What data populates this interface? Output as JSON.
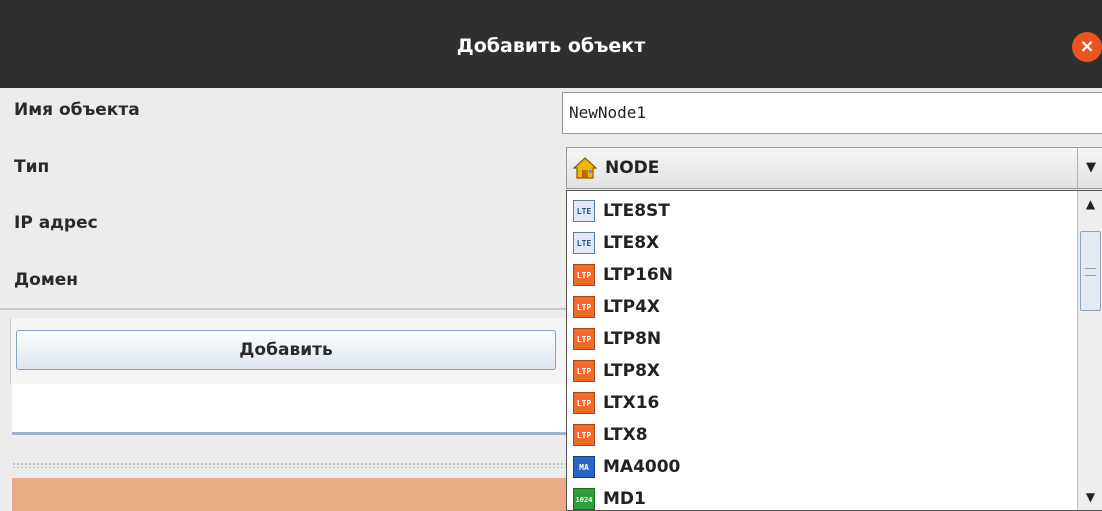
{
  "window": {
    "title": "Добавить объект",
    "close_icon": "×"
  },
  "form": {
    "name_label": "Имя объекта",
    "name_value": "NewNode1",
    "type_label": "Тип",
    "type_value": "NODE",
    "ip_label": "IP адрес",
    "domain_label": "Домен",
    "add_button": "Добавить"
  },
  "type_dropdown": {
    "items": [
      {
        "label": "LTE8ST",
        "icon": "lte-icon",
        "icon_text": "LTE"
      },
      {
        "label": "LTE8X",
        "icon": "lte-icon",
        "icon_text": "LTE"
      },
      {
        "label": "LTP16N",
        "icon": "ltp-icon",
        "icon_text": "LTP"
      },
      {
        "label": "LTP4X",
        "icon": "ltp-icon",
        "icon_text": "LTP"
      },
      {
        "label": "LTP8N",
        "icon": "ltp-icon",
        "icon_text": "LTP"
      },
      {
        "label": "LTP8X",
        "icon": "ltp-icon",
        "icon_text": "LTP"
      },
      {
        "label": "LTX16",
        "icon": "ltp-icon",
        "icon_text": "LTP"
      },
      {
        "label": "LTX8",
        "icon": "ltp-icon",
        "icon_text": "LTP"
      },
      {
        "label": "MA4000",
        "icon": "ma-icon",
        "icon_text": "MA"
      },
      {
        "label": "MD1",
        "icon": "md-icon",
        "icon_text": "1024"
      }
    ]
  },
  "colors": {
    "titlebar": "#2f2f2f",
    "close": "#e95420",
    "orange_panel": "#e8ab86"
  }
}
